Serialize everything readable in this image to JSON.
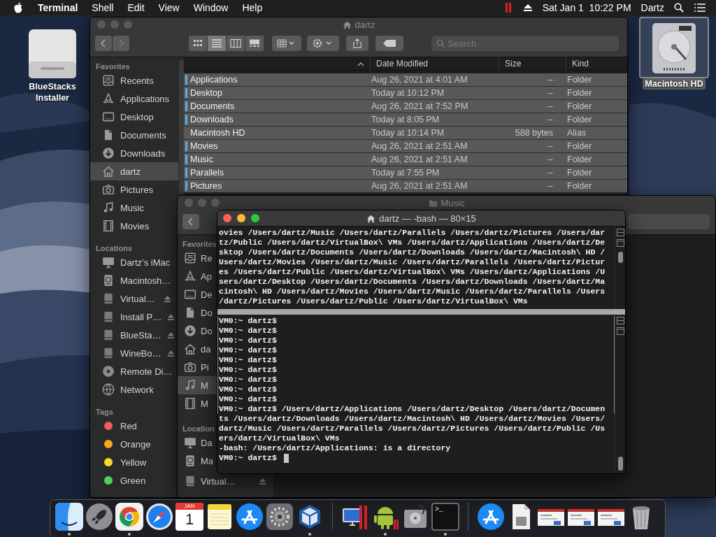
{
  "menu_bar": {
    "app": "Terminal",
    "menus": [
      "Shell",
      "Edit",
      "View",
      "Window",
      "Help"
    ],
    "clock": "Sat Jan 1  10:22 PM",
    "user": "Dartz"
  },
  "desktop_icons": [
    {
      "kind": "drive",
      "label": "BlueStacks Installer",
      "selected": false
    },
    {
      "kind": "hard-disk",
      "label": "Macintosh HD",
      "selected": true
    }
  ],
  "finder": {
    "title": "dartz",
    "views": [
      {
        "kind": "icons",
        "selected": false
      },
      {
        "kind": "list",
        "selected": true
      },
      {
        "kind": "columns",
        "selected": false
      },
      {
        "kind": "gallery",
        "selected": false
      }
    ],
    "search": {
      "placeholder": "Search"
    },
    "sidebar": [
      {
        "heading": "Favorites",
        "items": [
          {
            "kind": "recents",
            "label": "Recents",
            "selected": false
          },
          {
            "kind": "applications",
            "label": "Applications",
            "selected": false
          },
          {
            "kind": "desktop",
            "label": "Desktop",
            "selected": false
          },
          {
            "kind": "documents",
            "label": "Documents",
            "selected": false
          },
          {
            "kind": "downloads",
            "label": "Downloads",
            "selected": false
          },
          {
            "kind": "home",
            "label": "dartz",
            "selected": true
          },
          {
            "kind": "pictures",
            "label": "Pictures",
            "selected": false
          },
          {
            "kind": "music",
            "label": "Music",
            "selected": false
          },
          {
            "kind": "movies",
            "label": "Movies",
            "selected": false
          }
        ]
      },
      {
        "heading": "Locations",
        "items": [
          {
            "kind": "computer",
            "label": "Dartz’s iMac",
            "selected": false,
            "ejectable": false
          },
          {
            "kind": "hard-disk",
            "label": "Macintosh…",
            "selected": false,
            "ejectable": false
          },
          {
            "kind": "drive",
            "label": "Virtual…",
            "selected": false,
            "ejectable": true
          },
          {
            "kind": "drive",
            "label": "Install P…",
            "selected": false,
            "ejectable": true
          },
          {
            "kind": "drive",
            "label": "BlueSta…",
            "selected": false,
            "ejectable": true
          },
          {
            "kind": "drive",
            "label": "WineBo…",
            "selected": false,
            "ejectable": true
          },
          {
            "kind": "disc",
            "label": "Remote Di…",
            "selected": false,
            "ejectable": false
          },
          {
            "kind": "network",
            "label": "Network",
            "selected": false,
            "ejectable": false
          }
        ]
      },
      {
        "heading": "Tags",
        "items": [
          {
            "kind": "tag",
            "label": "Red",
            "color": "#ec5d5b",
            "selected": false
          },
          {
            "kind": "tag",
            "label": "Orange",
            "color": "#f5a623",
            "selected": false
          },
          {
            "kind": "tag",
            "label": "Yellow",
            "color": "#f3dc2a",
            "selected": false
          },
          {
            "kind": "tag",
            "label": "Green",
            "color": "#4fd35a",
            "selected": false
          }
        ]
      }
    ],
    "columns": [
      "Date Modified",
      "Size",
      "Kind"
    ],
    "rows": [
      {
        "name": "Applications",
        "date": "Aug 26, 2021 at 4:01 AM",
        "size": "--",
        "type": "Folder",
        "marked": true,
        "selected": true
      },
      {
        "name": "Desktop",
        "date": "Today at 10:12 PM",
        "size": "--",
        "type": "Folder",
        "marked": true,
        "selected": true
      },
      {
        "name": "Documents",
        "date": "Aug 26, 2021 at 7:52 PM",
        "size": "--",
        "type": "Folder",
        "marked": true,
        "selected": true
      },
      {
        "name": "Downloads",
        "date": "Today at 8:05 PM",
        "size": "--",
        "type": "Folder",
        "marked": true,
        "selected": true
      },
      {
        "name": "Macintosh HD",
        "date": "Today at 10:14 PM",
        "size": "588 bytes",
        "type": "Alias",
        "marked": false,
        "selected": true
      },
      {
        "name": "Movies",
        "date": "Aug 26, 2021 at 2:51 AM",
        "size": "--",
        "type": "Folder",
        "marked": true,
        "selected": true
      },
      {
        "name": "Music",
        "date": "Aug 26, 2021 at 2:51 AM",
        "size": "--",
        "type": "Folder",
        "marked": true,
        "selected": true
      },
      {
        "name": "Parallels",
        "date": "Today at 7:55 PM",
        "size": "--",
        "type": "Folder",
        "marked": true,
        "selected": true
      },
      {
        "name": "Pictures",
        "date": "Aug 26, 2021 at 2:51 AM",
        "size": "--",
        "type": "Folder",
        "marked": true,
        "selected": true
      }
    ]
  },
  "music_window": {
    "title": "Music",
    "sidebar": [
      {
        "heading": "Favorites",
        "items": [
          {
            "kind": "recents",
            "label": "Re",
            "selected": false
          },
          {
            "kind": "applications",
            "label": "Ap",
            "selected": false
          },
          {
            "kind": "desktop",
            "label": "De",
            "selected": false
          },
          {
            "kind": "documents",
            "label": "Do",
            "selected": false
          },
          {
            "kind": "downloads",
            "label": "Do",
            "selected": false
          },
          {
            "kind": "home",
            "label": "da",
            "selected": false
          },
          {
            "kind": "pictures",
            "label": "Pi",
            "selected": false
          },
          {
            "kind": "music",
            "label": "M",
            "selected": true
          },
          {
            "kind": "movies",
            "label": "M",
            "selected": false
          }
        ]
      },
      {
        "heading": "Location",
        "items": [
          {
            "kind": "computer",
            "label": "Da",
            "selected": false
          },
          {
            "kind": "hard-disk",
            "label": "Ma",
            "selected": false
          },
          {
            "kind": "drive",
            "label": "Virtual…",
            "selected": false,
            "ejectable": true
          }
        ]
      }
    ]
  },
  "terminal": {
    "title": "dartz — -bash — 80×15",
    "top_lines": [
      "ovies /Users/dartz/Music /Users/dartz/Parallels /Users/dartz/Pictures /Users/dar",
      "tz/Public /Users/dartz/VirtualBox\\ VMs /Users/dartz/Applications /Users/dartz/De",
      "sktop /Users/dartz/Documents /Users/dartz/Downloads /Users/dartz/Macintosh\\ HD /",
      "Users/dartz/Movies /Users/dartz/Music /Users/dartz/Parallels /Users/dartz/Pictur",
      "es /Users/dartz/Public /Users/dartz/VirtualBox\\ VMs /Users/dartz/Applications /U",
      "sers/dartz/Desktop /Users/dartz/Documents /Users/dartz/Downloads /Users/dartz/Ma",
      "cintosh\\ HD /Users/dartz/Movies /Users/dartz/Music /Users/dartz/Parallels /Users",
      "/dartz/Pictures /Users/dartz/Public /Users/dartz/VirtualBox\\ VMs"
    ],
    "bottom_lines": [
      {
        "text": "VM0:~ dartz$",
        "marked": true
      },
      {
        "text": "VM0:~ dartz$",
        "marked": true
      },
      {
        "text": "VM0:~ dartz$",
        "marked": true
      },
      {
        "text": "VM0:~ dartz$",
        "marked": true
      },
      {
        "text": "VM0:~ dartz$",
        "marked": true
      },
      {
        "text": "VM0:~ dartz$",
        "marked": true
      },
      {
        "text": "VM0:~ dartz$",
        "marked": true
      },
      {
        "text": "VM0:~ dartz$",
        "marked": true
      },
      {
        "text": "VM0:~ dartz$",
        "marked": true
      },
      {
        "text": "VM0:~ dartz$ /Users/dartz/Applications /Users/dartz/Desktop /Users/dartz/Documen",
        "marked": true
      },
      {
        "text": "ts /Users/dartz/Downloads /Users/dartz/Macintosh\\ HD /Users/dartz/Movies /Users/",
        "marked": false
      },
      {
        "text": "dartz/Music /Users/dartz/Parallels /Users/dartz/Pictures /Users/dartz/Public /Us",
        "marked": false
      },
      {
        "text": "ers/dartz/VirtualBox\\ VMs",
        "marked": false
      },
      {
        "text": "-bash: /Users/dartz/Applications: is a directory",
        "marked": false
      },
      {
        "text": "VM0:~ dartz$",
        "marked": false
      }
    ]
  },
  "dock": {
    "items": [
      {
        "kind": "finder",
        "running": true
      },
      {
        "kind": "rocket",
        "running": false
      },
      {
        "kind": "chrome",
        "running": true
      },
      {
        "kind": "compass",
        "running": false
      },
      {
        "kind": "calendar",
        "month": "JAN",
        "day": "1",
        "running": false
      },
      {
        "kind": "notes",
        "running": false
      },
      {
        "kind": "appstore",
        "running": false
      },
      {
        "kind": "gear",
        "running": false
      },
      {
        "kind": "cube",
        "running": true
      },
      {
        "kind": "separator"
      },
      {
        "kind": "monitor",
        "running": false
      },
      {
        "kind": "robot",
        "running": true
      },
      {
        "kind": "disk",
        "running": false
      },
      {
        "kind": "terminal",
        "prompt": ">_",
        "running": true
      },
      {
        "kind": "separator"
      },
      {
        "kind": "appstore",
        "running": false
      },
      {
        "kind": "document",
        "running": false
      },
      {
        "kind": "thumbnail",
        "running": false
      },
      {
        "kind": "thumbnail",
        "running": false
      },
      {
        "kind": "thumbnail",
        "running": false
      },
      {
        "kind": "trash",
        "running": false
      }
    ]
  }
}
